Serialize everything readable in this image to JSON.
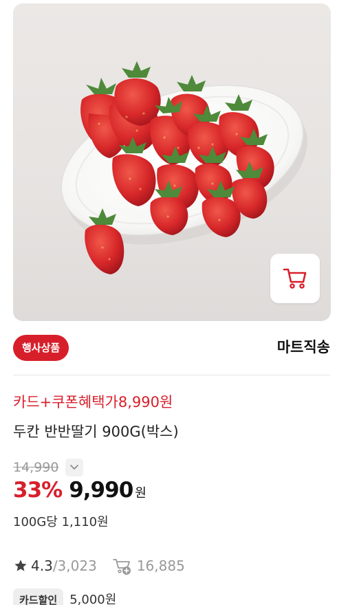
{
  "product": {
    "image_alt": "strawberries",
    "event_badge": "행사상품",
    "seller": "마트직송",
    "promo_text": "카드+쿠폰혜택가8,990원",
    "title": "두칸 반반딸기 900G(박스)",
    "original_price": "14,990",
    "discount": "33%",
    "price": "9,990",
    "currency": "원",
    "unit_price": "100G당 1,110원",
    "rating": "4.3",
    "review_count": "/3,023",
    "cart_count": "16,885",
    "card_label": "카드할인",
    "card_amount": "5,000원"
  },
  "icons": {
    "cart": "cart-icon",
    "chevron": "chevron-down-icon",
    "star": "star-icon",
    "cart_add": "cart-add-icon"
  },
  "colors": {
    "accent": "#d71f2b",
    "muted": "#999999"
  }
}
